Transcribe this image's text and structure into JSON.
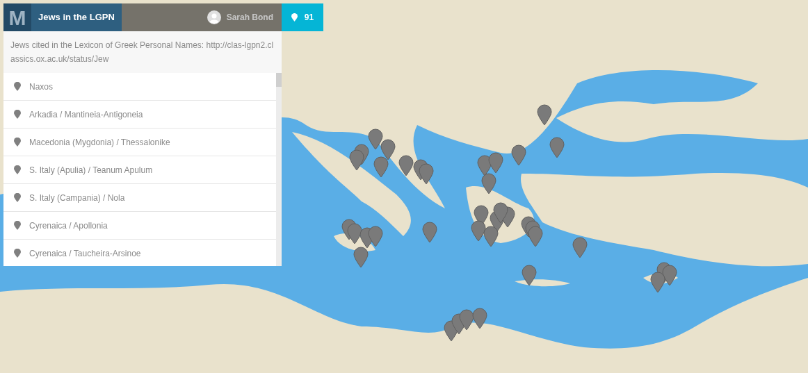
{
  "header": {
    "logo": "M",
    "title": "Jews in the LGPN",
    "user": "Sarah Bond",
    "marker_count": "91"
  },
  "description": "Jews cited in the Lexicon of Greek Personal Names: http://clas-lgpn2.classics.ox.ac.uk/status/Jew",
  "places": [
    {
      "label": "Naxos"
    },
    {
      "label": "Arkadia / Mantineia-Antigoneia"
    },
    {
      "label": "Macedonia (Mygdonia) / Thessalonike"
    },
    {
      "label": "S. Italy (Apulia) / Teanum Apulum"
    },
    {
      "label": "S. Italy (Campania) / Nola"
    },
    {
      "label": "Cyrenaica / Apollonia"
    },
    {
      "label": "Cyrenaica / Taucheira-Arsinoe"
    }
  ]
}
